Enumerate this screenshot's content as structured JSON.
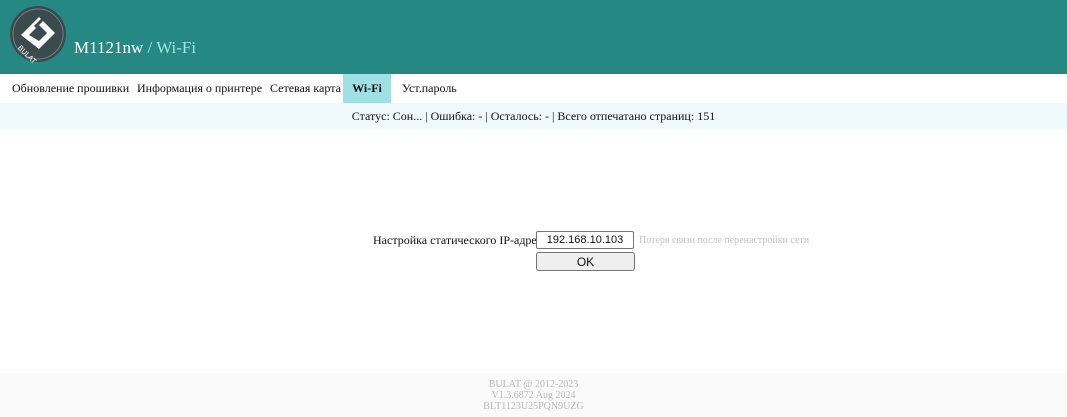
{
  "header": {
    "model": "M1121nw",
    "separator": " / ",
    "section": "Wi-Fi",
    "logo_icon": "bulat-logo-icon",
    "logo_text": "BULAT"
  },
  "nav": {
    "items": [
      {
        "label": "Обновление прошивки"
      },
      {
        "label": "Информация о принтере"
      },
      {
        "label": "Сетевая карта"
      },
      {
        "label": "Wi-Fi",
        "active": true
      },
      {
        "label": "Уст.пароль"
      }
    ]
  },
  "status": {
    "text": "Статус: Сон...  | Ошибка: -  | Осталось: -  | Всего отпечатано страниц: 151"
  },
  "form": {
    "label": "Настройка статического IP-адреса",
    "ip_value": "192.168.10.103",
    "hint": "Потеря связи после перенастройки сети",
    "ok_label": "OK"
  },
  "footer": {
    "line1": "BULAT @ 2012-2023",
    "line2": "V1.3.6872 Aug 2024",
    "line3": "BLT1123U25PQN9UZG"
  },
  "colors": {
    "header_bg": "#258883",
    "active_tab": "#9fe0e4",
    "status_bg": "#eff8fb",
    "subtitle": "#9fe3df"
  }
}
